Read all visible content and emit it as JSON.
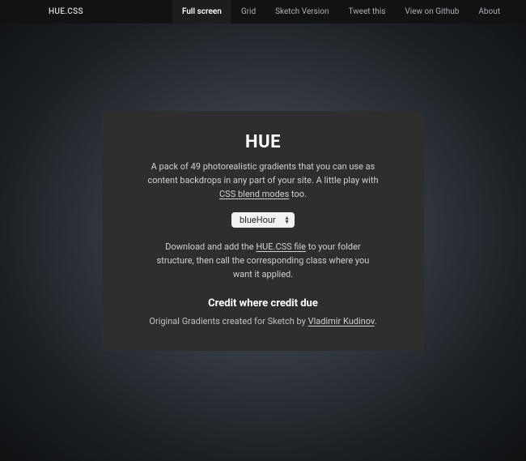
{
  "brand": "HUE.CSS",
  "nav": [
    {
      "label": "Full screen",
      "active": true
    },
    {
      "label": "Grid",
      "active": false
    },
    {
      "label": "Sketch Version",
      "active": false
    },
    {
      "label": "Tweet this",
      "active": false
    },
    {
      "label": "View on Github",
      "active": false
    },
    {
      "label": "About",
      "active": false
    }
  ],
  "card": {
    "title": "HUE",
    "intro_pre": "A pack of 49 photorealistic gradients that you can use as content backdrops in any part of your site. A little play with ",
    "intro_link": "CSS blend modes",
    "intro_post": " too.",
    "select_value": "blueHour",
    "download_pre": "Download and add the ",
    "download_link": "HUE.CSS file",
    "download_post": " to your folder structure, then call the corresponding class where you want it applied.",
    "credit_heading": "Credit where credit due",
    "credit_pre": "Original Gradients created for Sketch by ",
    "credit_link": "Vladimir Kudinov",
    "credit_post": "."
  }
}
